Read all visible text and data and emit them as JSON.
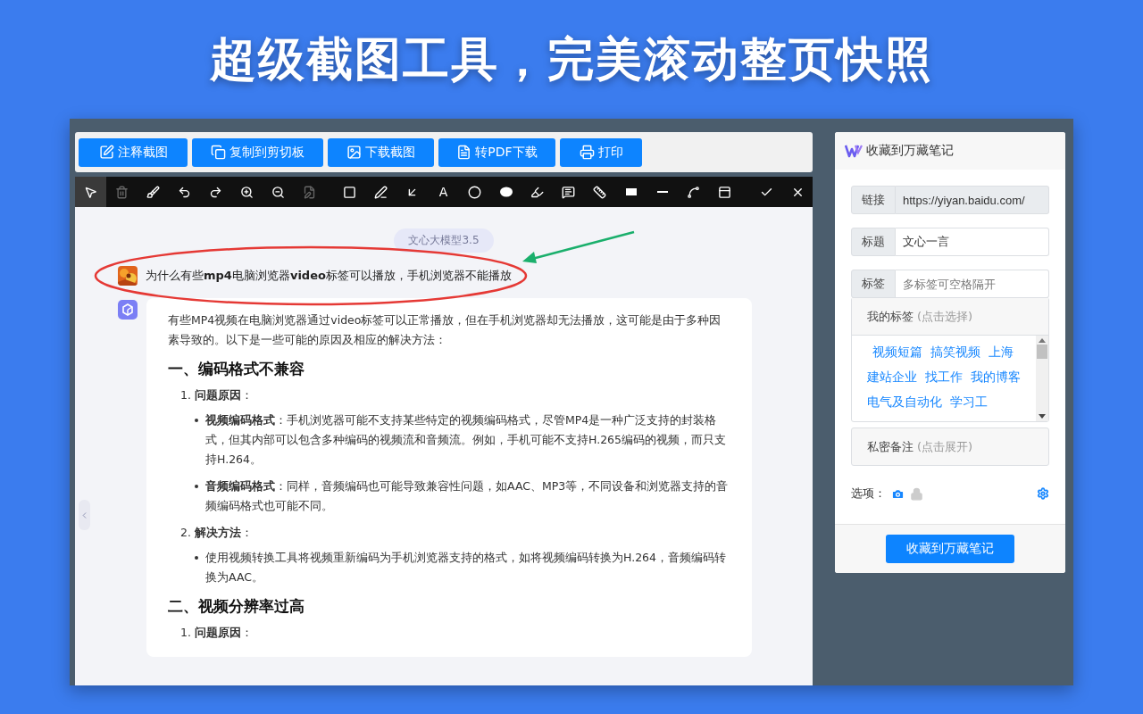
{
  "headline": "超级截图工具，完美滚动整页快照",
  "actions": [
    {
      "label": "注释截图"
    },
    {
      "label": "复制到剪切板"
    },
    {
      "label": "下载截图"
    },
    {
      "label": "转PDF下载"
    },
    {
      "label": "打印"
    }
  ],
  "tools": [
    {
      "selected": true,
      "disabled": false
    },
    {
      "selected": false,
      "disabled": true
    },
    {
      "selected": false,
      "disabled": false
    },
    {
      "selected": false,
      "disabled": false
    },
    {
      "selected": false,
      "disabled": false
    },
    {
      "selected": false,
      "disabled": false
    },
    {
      "selected": false,
      "disabled": false
    },
    {
      "selected": false,
      "disabled": true
    },
    {
      "selected": false,
      "disabled": false
    },
    {
      "selected": false,
      "disabled": false
    },
    {
      "selected": false,
      "disabled": false
    },
    {
      "selected": false,
      "disabled": false,
      "label": "A"
    },
    {
      "selected": false,
      "disabled": false
    },
    {
      "selected": false,
      "disabled": false
    },
    {
      "selected": false,
      "disabled": false
    },
    {
      "selected": false,
      "disabled": false
    },
    {
      "selected": false,
      "disabled": false
    },
    {
      "selected": false,
      "disabled": false
    },
    {
      "selected": false,
      "disabled": false
    },
    {
      "selected": false,
      "disabled": false
    },
    {
      "selected": false,
      "disabled": false
    },
    {
      "selected": false,
      "disabled": false
    },
    {
      "selected": false,
      "disabled": false
    }
  ],
  "chat": {
    "model_badge": "文心大模型3.5",
    "question": "为什么有些**mp4**电脑浏览器**video**标签可以播放，手机浏览器不能播放",
    "answer": {
      "intro": "有些MP4视频在电脑浏览器通过video标签可以正常播放，但在手机浏览器却无法播放，这可能是由于多种因素导致的。以下是一些可能的原因及相应的解决方法：",
      "sections": [
        {
          "heading": "一、编码格式不兼容",
          "items": [
            {
              "number": "1.",
              "label": "问题原因",
              "colon": "：",
              "points": [
                "**视频编码格式**：手机浏览器可能不支持某些特定的视频编码格式，尽管MP4是一种广泛支持的封装格式，但其内部可以包含多种编码的视频流和音频流。例如，手机可能不支持H.265编码的视频，而只支持H.264。",
                "**音频编码格式**：同样，音频编码也可能导致兼容性问题，如AAC、MP3等，不同设备和浏览器支持的音频编码格式也可能不同。"
              ]
            },
            {
              "number": "2.",
              "label": "解决方法",
              "colon": "：",
              "points": [
                "使用视频转换工具将视频重新编码为手机浏览器支持的格式，如将视频编码转换为H.264，音频编码转换为AAC。"
              ]
            }
          ]
        },
        {
          "heading": "二、视频分辨率过高",
          "items": [
            {
              "number": "1.",
              "label": "问题原因",
              "colon": "："
            }
          ]
        }
      ]
    }
  },
  "clipper": {
    "title": "收藏到万藏笔记",
    "fields": [
      {
        "label": "链接",
        "value": "https://yiyan.baidu.com/",
        "readonly": true
      },
      {
        "label": "标题",
        "value": "文心一言",
        "readonly": false
      },
      {
        "label": "标签",
        "placeholder": "多标签可空格隔开",
        "readonly": false
      }
    ],
    "my_tags": {
      "title": "我的标签",
      "hint": "(点击选择)",
      "tags": [
        "视频短篇",
        "搞笑视频",
        "上海",
        "建站企业",
        "找工作",
        "我的博客",
        "电气及自动化",
        "学习工"
      ]
    },
    "private_note": {
      "title": "私密备注",
      "hint": "(点击展开)"
    },
    "options_label": "选项：",
    "options": [
      {
        "on": true
      },
      {
        "on": false
      }
    ],
    "submit": "收藏到万藏笔记"
  }
}
